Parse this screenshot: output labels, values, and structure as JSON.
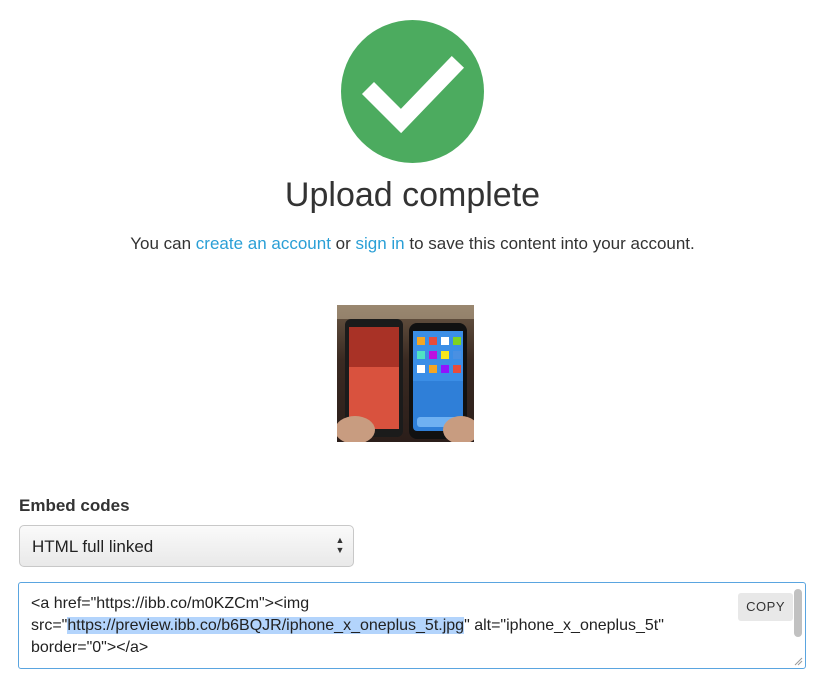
{
  "status": {
    "icon": "checkmark-icon",
    "title": "Upload complete",
    "message_prefix": "You can ",
    "create_account_link": "create an account",
    "message_or": " or ",
    "sign_in_link": "sign in",
    "message_suffix": " to save this content into your account."
  },
  "preview": {
    "alt": "iphone_x_oneplus_5t"
  },
  "embed": {
    "label": "Embed codes",
    "selected_format": "HTML full linked",
    "code_before": "<a href=\"https://ibb.co/m0KZCm\"><img\nsrc=\"",
    "code_highlight": "https://preview.ibb.co/b6BQJR/iphone_x_oneplus_5t.jpg",
    "code_after": "\" alt=\"iphone_x_oneplus_5t\"\nborder=\"0\"></a>",
    "copy_label": "COPY"
  },
  "colors": {
    "success_green": "#4cab5f",
    "link_blue": "#2a9fd6",
    "focus_blue": "#5aa5e0",
    "selection_blue": "#b3d4fc"
  }
}
